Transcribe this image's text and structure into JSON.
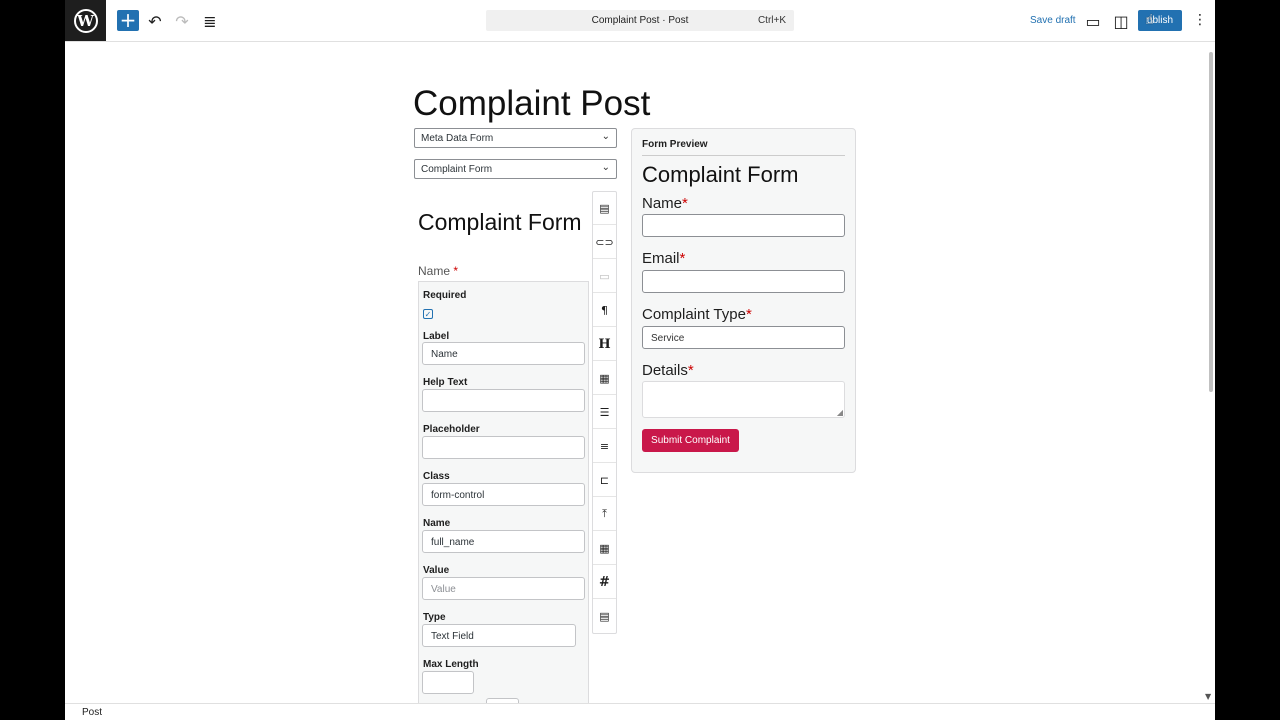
{
  "toolbar": {
    "document_title": "Complaint Post · Post",
    "shortcut": "Ctrl+K",
    "save_draft": "Save draft",
    "publish": "ublish",
    "icons": [
      "wordpress-logo-icon",
      "add-block-icon",
      "undo-icon",
      "redo-icon",
      "document-overview-icon",
      "preview-icon",
      "settings-sidebar-icon",
      "options-icon"
    ]
  },
  "post": {
    "title": "Complaint Post",
    "select_meta": "Meta Data Form",
    "select_form": "Complaint Form"
  },
  "editor": {
    "form_title": "Complaint Form",
    "field_label": "Name",
    "required_mark": "*",
    "settings": {
      "required_label": "Required",
      "required_checked": true,
      "label_label": "Label",
      "label_value": "Name",
      "help_label": "Help Text",
      "help_value": "",
      "placeholder_label": "Placeholder",
      "placeholder_value": "",
      "class_label": "Class",
      "class_value": "form-control",
      "name_label": "Name",
      "name_value": "full_name",
      "value_label": "Value",
      "value_placeholder": "Value",
      "type_label": "Type",
      "type_value": "Text Field",
      "maxlength_label": "Max Length"
    },
    "tools": [
      "contact-card-icon",
      "link-field-icon",
      "input-field-icon",
      "paragraph-icon",
      "heading-icon",
      "form-block-icon",
      "list-icon",
      "checklist-icon",
      "button-field-icon",
      "upload-icon",
      "calendar-icon",
      "number-icon",
      "textarea-icon"
    ]
  },
  "preview": {
    "heading": "Form Preview",
    "title": "Complaint Form",
    "name_label": "Name",
    "email_label": "Email",
    "type_label": "Complaint Type",
    "type_value": "Service",
    "details_label": "Details",
    "required_mark": "*",
    "submit": "Submit Complaint",
    "submit_color": "#c9184a"
  },
  "status": {
    "breadcrumb": "Post"
  }
}
